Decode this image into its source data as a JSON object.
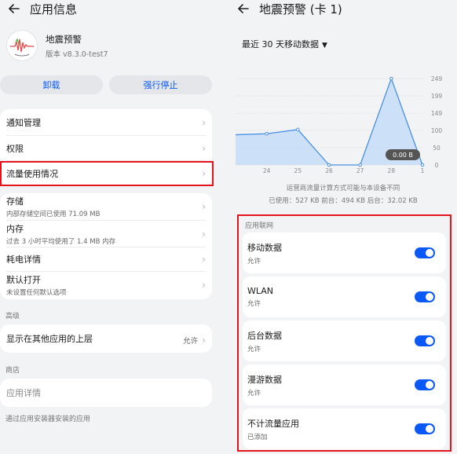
{
  "left": {
    "header": {
      "title": "应用信息"
    },
    "app": {
      "name": "地震预警",
      "version": "版本 v8.3.0-test7"
    },
    "buttons": {
      "uninstall": "卸载",
      "force_stop": "强行停止"
    },
    "group1": {
      "notifications": "通知管理",
      "permissions": "权限",
      "data_usage": "流量使用情况"
    },
    "group2": {
      "storage": {
        "label": "存储",
        "sub": "内部存储空间已使用 71.09 MB"
      },
      "memory": {
        "label": "内存",
        "sub": "过去 3 小时平均使用了 1.4 MB 内存"
      },
      "battery": {
        "label": "耗电详情"
      },
      "default_open": {
        "label": "默认打开",
        "sub": "未设置任何默认选项"
      }
    },
    "advanced": {
      "header": "高级",
      "overlay": {
        "label": "显示在其他应用的上层",
        "value": "允许"
      }
    },
    "store": {
      "header": "商店",
      "details": "应用详情",
      "footer": "通过应用安装器安装的应用"
    }
  },
  "right": {
    "header": {
      "title": "地震预警 (卡 1)"
    },
    "data_selector": "最近 30 天移动数据",
    "tooltip": "0.00 B",
    "notice": "运营商流量计算方式可能与本设备不同",
    "summary": "已使用：527 KB 前台：494 KB 后台：32.02 KB",
    "network": {
      "header": "应用联网",
      "items": [
        {
          "label": "移动数据",
          "sub": "允许",
          "on": true
        },
        {
          "label": "WLAN",
          "sub": "允许",
          "on": true
        },
        {
          "label": "后台数据",
          "sub": "允许",
          "on": true
        },
        {
          "label": "漫游数据",
          "sub": "允许",
          "on": true
        },
        {
          "label": "不计流量应用",
          "sub": "已添加",
          "on": true
        }
      ]
    }
  },
  "chart_data": {
    "type": "area",
    "categories": [
      "24",
      "25",
      "26",
      "27",
      "28",
      "1"
    ],
    "x": [
      "23",
      "24",
      "25",
      "26",
      "27",
      "28",
      "1"
    ],
    "values": [
      87,
      90,
      102,
      0,
      0,
      249,
      0
    ],
    "y_ticks": [
      0,
      50,
      100,
      149,
      199,
      249
    ],
    "ylim": [
      0,
      249
    ],
    "line_color": "#4a90e2",
    "fill_color": "#c6dcf7"
  },
  "colors": {
    "accent": "#0a59f7",
    "highlight": "#e3141c"
  }
}
